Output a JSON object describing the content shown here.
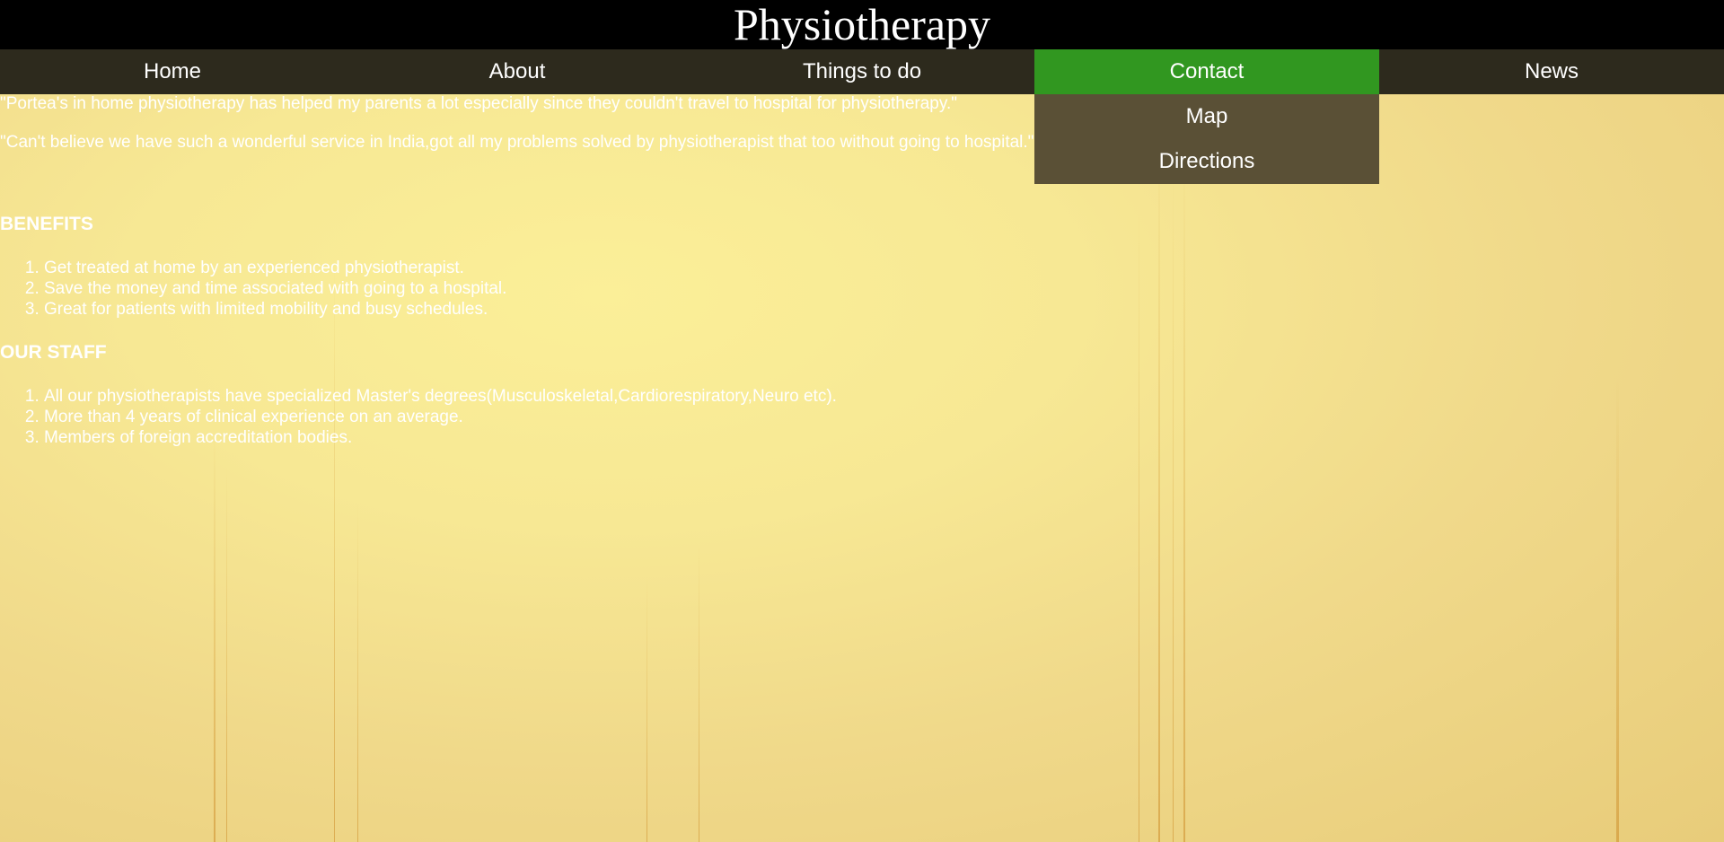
{
  "header": {
    "title": "Physiotherapy"
  },
  "nav": {
    "items": [
      {
        "label": "Home"
      },
      {
        "label": "About"
      },
      {
        "label": "Things to do"
      },
      {
        "label": "Contact"
      },
      {
        "label": "News"
      }
    ],
    "active": "Contact"
  },
  "dropdown": {
    "items": [
      {
        "label": "Map"
      },
      {
        "label": "Directions"
      }
    ]
  },
  "testimonials": {
    "quote1": "\"Portea's in home physiotherapy has helped my parents a lot especially since they couldn't travel to hospital for physiotherapy.\"",
    "quote2": "\"Can't believe we have such a wonderful service in India,got all my problems solved by physiotherapist that too without going to hospital.\""
  },
  "benefits": {
    "title": "BENEFITS",
    "items": [
      "Get treated at home by an experienced physiotherapist.",
      "Save the money and time associated with going to a hospital.",
      "Great for patients with limited mobility and busy schedules."
    ]
  },
  "staff": {
    "title": "OUR STAFF",
    "items": [
      "All our physiotherapists have specialized Master's degrees(Musculoskeletal,Cardiorespiratory,Neuro etc).",
      "More than 4 years of clinical experience on an average.",
      "Members of foreign accreditation bodies."
    ]
  },
  "colors": {
    "header_bg": "#000000",
    "nav_bg": "#2d2a1d",
    "nav_active": "#319720",
    "dropdown_bg": "#5a5036",
    "text": "#ffffff"
  }
}
